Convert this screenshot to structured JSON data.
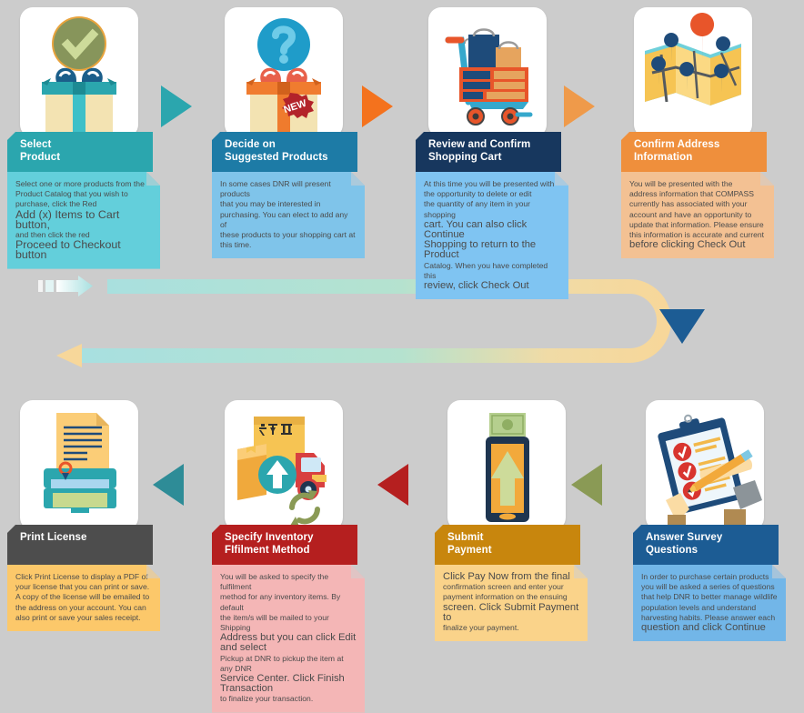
{
  "diagram": {
    "title": "DNR COMPASS Online Purchase Workflow",
    "background_color": "#cccccc"
  },
  "steps": [
    {
      "id": "select-product",
      "icon": "gift-check-icon",
      "title": "Select\nProduct",
      "header_color": "#2ba6ae",
      "note_color": "#63cfdb",
      "note_lines": [
        {
          "text": "Select one or more products from the",
          "size": "small"
        },
        {
          "text": "Product Catalog that you wish to",
          "size": "small"
        },
        {
          "text": "purchase, click the Red",
          "size": "small"
        },
        {
          "text": "Add (x) Items to Cart button,",
          "size": "big"
        },
        {
          "text": "and then click the red",
          "size": "small"
        },
        {
          "text": "Proceed to Checkout button",
          "size": "big"
        }
      ]
    },
    {
      "id": "decide-suggested-products",
      "icon": "gift-question-new-icon",
      "title": "Decide on\nSuggested Products",
      "header_color": "#1d7ba6",
      "note_color": "#7fc4ea",
      "note_lines": [
        {
          "text": "In some cases DNR will present products",
          "size": "small"
        },
        {
          "text": "that you may be interested in",
          "size": "small"
        },
        {
          "text": "purchasing. You can elect to add any of",
          "size": "small"
        },
        {
          "text": "these products to your shopping cart at",
          "size": "small"
        },
        {
          "text": "this time.",
          "size": "small"
        }
      ]
    },
    {
      "id": "review-confirm-cart",
      "icon": "shopping-cart-icon",
      "title": "Review and Confirm\nShopping Cart",
      "header_color": "#17375e",
      "note_color": "#7fc4f2",
      "note_lines": [
        {
          "text": "At this time you will be presented with",
          "size": "small"
        },
        {
          "text": "the opportunity to delete or edit",
          "size": "small"
        },
        {
          "text": "the quantity of any item in your  shopping",
          "size": "small"
        },
        {
          "text": "cart. You can also click Continue",
          "size": "mixed-continue"
        },
        {
          "text": "Shopping to return to the Product",
          "size": "mixed-shopping"
        },
        {
          "text": "Catalog. When you have completed this",
          "size": "small"
        },
        {
          "text": "review, click Check Out",
          "size": "mixed-checkout"
        }
      ]
    },
    {
      "id": "confirm-address",
      "icon": "map-pins-icon",
      "title": "Confirm Address\nInformation",
      "header_color": "#ef8f3c",
      "note_color": "#f3c193",
      "note_lines": [
        {
          "text": "You will be presented with the",
          "size": "small"
        },
        {
          "text": "address information that COMPASS",
          "size": "small"
        },
        {
          "text": "currently has associated with your",
          "size": "small"
        },
        {
          "text": "account and have an opportunity to",
          "size": "small"
        },
        {
          "text": "update that information. Please ensure",
          "size": "small"
        },
        {
          "text": "this information is accurate and current",
          "size": "small"
        },
        {
          "text": "before clicking Check Out",
          "size": "mixed-checkout"
        }
      ]
    },
    {
      "id": "print-license",
      "icon": "printer-license-icon",
      "title": "Print License",
      "header_color": "#4d4d4d",
      "note_color": "#fcc86a",
      "note_lines": [
        {
          "text": "Click Print License to display a PDF of",
          "size": "small"
        },
        {
          "text": "your license that you can print or save.",
          "size": "small"
        },
        {
          "text": "A copy of the license will be emailed to",
          "size": "small"
        },
        {
          "text": "the address on your account. You can",
          "size": "small"
        },
        {
          "text": "also print or save your sales receipt.",
          "size": "small"
        }
      ]
    },
    {
      "id": "specify-inventory-fulfilment",
      "icon": "boxes-truck-icon",
      "title": "Specify Inventory\nFIfilment Method",
      "header_color": "#b51f1f",
      "note_color": "#f4b6b6",
      "note_lines": [
        {
          "text": "You will be asked to specify the fulfilment",
          "size": "small"
        },
        {
          "text": "method for any inventory items. By default",
          "size": "small"
        },
        {
          "text": "the item/s will be mailed to your Shipping",
          "size": "small"
        },
        {
          "text": "Address but you can click Edit and select",
          "size": "mixed-edit"
        },
        {
          "text": "Pickup at DNR to pickup the item at any DNR",
          "size": "small"
        },
        {
          "text": "Service Center. Click Finish Transaction",
          "size": "mixed-finish"
        },
        {
          "text": "to finalize your transaction.",
          "size": "small"
        }
      ]
    },
    {
      "id": "submit-payment",
      "icon": "mobile-payment-icon",
      "title": "Submit\nPayment",
      "header_color": "#c8860d",
      "note_color": "#fad38a",
      "note_lines": [
        {
          "text": "Click Pay Now from the final",
          "size": "mixed-paynow"
        },
        {
          "text": "confirmation screen and enter your",
          "size": "small"
        },
        {
          "text": "payment information on the ensuing",
          "size": "small"
        },
        {
          "text": "screen. Click Submit Payment to",
          "size": "mixed-submit"
        },
        {
          "text": "finalize your payment.",
          "size": "small"
        }
      ]
    },
    {
      "id": "answer-survey-questions",
      "icon": "clipboard-survey-icon",
      "title": "Answer Survey\nQuestions",
      "header_color": "#1c5c94",
      "note_color": "#72b6e8",
      "note_lines": [
        {
          "text": "In order to purchase certain products",
          "size": "small"
        },
        {
          "text": "you will be asked a series of questions",
          "size": "small"
        },
        {
          "text": "that help DNR to better manage wildlife",
          "size": "small"
        },
        {
          "text": "population levels and understand",
          "size": "small"
        },
        {
          "text": "harvesting habits. Please answer each",
          "size": "small"
        },
        {
          "text": "question and click Continue",
          "size": "mixed-continue2"
        }
      ]
    }
  ],
  "connectors": [
    {
      "id": "arrow-select-to-decide",
      "direction": "right",
      "color": "#2ba6ae"
    },
    {
      "id": "arrow-decide-to-review",
      "direction": "right",
      "color": "#f4721d"
    },
    {
      "id": "arrow-review-to-address",
      "direction": "right",
      "color": "#ef9a4a"
    },
    {
      "id": "arrow-address-down",
      "direction": "down",
      "color": "#1c5c94"
    },
    {
      "id": "arrow-survey-to-payment",
      "direction": "left",
      "color": "#8a9a55"
    },
    {
      "id": "arrow-payment-to-inventory",
      "direction": "left",
      "color": "#b51f1f"
    },
    {
      "id": "arrow-inventory-to-print",
      "direction": "left",
      "color": "#2e8c97"
    }
  ],
  "flow_path": {
    "id": "u-turn-loop",
    "start_color": "#a8e0e0",
    "end_color": "#f7d79a",
    "start_arrow": "dashed-fading-arrow-right",
    "end_arrow": "arrow-left"
  }
}
